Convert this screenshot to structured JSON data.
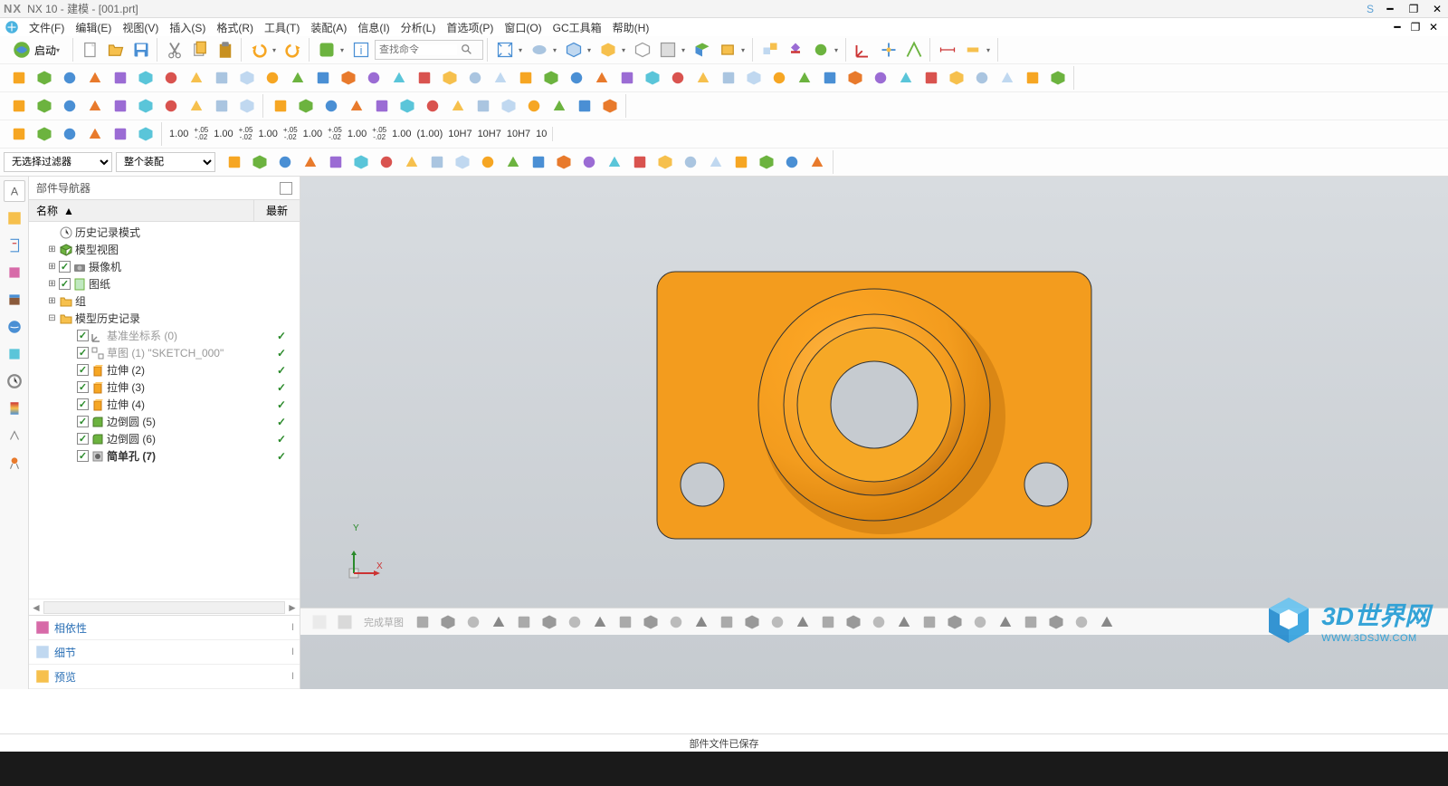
{
  "title": "NX 10 - 建模 - [001.prt]",
  "title_s": "S",
  "menus": [
    "文件(F)",
    "编辑(E)",
    "视图(V)",
    "插入(S)",
    "格式(R)",
    "工具(T)",
    "装配(A)",
    "信息(I)",
    "分析(L)",
    "首选项(P)",
    "窗口(O)",
    "GC工具箱",
    "帮助(H)"
  ],
  "start_label": "启动",
  "search_placeholder": "查找命令",
  "filter1": "无选择过滤器",
  "filter2": "整个装配",
  "nav_title": "部件导航器",
  "nav_col_name": "名称",
  "nav_col_latest": "最新",
  "tree": [
    {
      "indent": 0,
      "exp": "",
      "chk": false,
      "icon": "clock",
      "label": "历史记录模式",
      "gray": false,
      "status": ""
    },
    {
      "indent": 0,
      "exp": "+",
      "chk": false,
      "icon": "cube-g",
      "label": "模型视图",
      "gray": false,
      "status": ""
    },
    {
      "indent": 0,
      "exp": "+",
      "chk": true,
      "icon": "camera",
      "label": "摄像机",
      "gray": false,
      "status": ""
    },
    {
      "indent": 0,
      "exp": "+",
      "chk": true,
      "icon": "sheet",
      "label": "图纸",
      "gray": false,
      "status": ""
    },
    {
      "indent": 0,
      "exp": "+",
      "chk": false,
      "icon": "folder",
      "label": "组",
      "gray": false,
      "status": ""
    },
    {
      "indent": 0,
      "exp": "-",
      "chk": false,
      "icon": "folder",
      "label": "模型历史记录",
      "gray": false,
      "status": ""
    },
    {
      "indent": 1,
      "exp": "",
      "chk": true,
      "icon": "csys",
      "label": "基准坐标系 (0)",
      "gray": true,
      "status": "ok"
    },
    {
      "indent": 1,
      "exp": "",
      "chk": true,
      "icon": "sketch",
      "label": "草图 (1) \"SKETCH_000\"",
      "gray": true,
      "status": "ok"
    },
    {
      "indent": 1,
      "exp": "",
      "chk": true,
      "icon": "extrude",
      "label": "拉伸 (2)",
      "gray": false,
      "status": "ok"
    },
    {
      "indent": 1,
      "exp": "",
      "chk": true,
      "icon": "extrude",
      "label": "拉伸 (3)",
      "gray": false,
      "status": "ok"
    },
    {
      "indent": 1,
      "exp": "",
      "chk": true,
      "icon": "extrude",
      "label": "拉伸 (4)",
      "gray": false,
      "status": "ok"
    },
    {
      "indent": 1,
      "exp": "",
      "chk": true,
      "icon": "fillet",
      "label": "边倒圆 (5)",
      "gray": false,
      "status": "ok"
    },
    {
      "indent": 1,
      "exp": "",
      "chk": true,
      "icon": "fillet",
      "label": "边倒圆 (6)",
      "gray": false,
      "status": "ok"
    },
    {
      "indent": 1,
      "exp": "",
      "chk": true,
      "icon": "hole",
      "label": "简单孔 (7)",
      "gray": false,
      "bold": true,
      "status": "ok"
    }
  ],
  "sections": [
    {
      "label": "相依性",
      "icon": "dep"
    },
    {
      "label": "细节",
      "icon": "detail"
    },
    {
      "label": "预览",
      "icon": "preview"
    }
  ],
  "dims": [
    "1.00",
    "1.00",
    "1.00",
    "1.00",
    "1.00",
    "1.00",
    "(1.00)",
    "10H7",
    "10H7",
    "10H7",
    "10"
  ],
  "bottom_label": "完成草图",
  "status_text": "部件文件已保存",
  "watermark_title": "3D世界网",
  "watermark_url": "WWW.3DSJW.COM",
  "triad": {
    "x": "X",
    "y": "Y"
  }
}
